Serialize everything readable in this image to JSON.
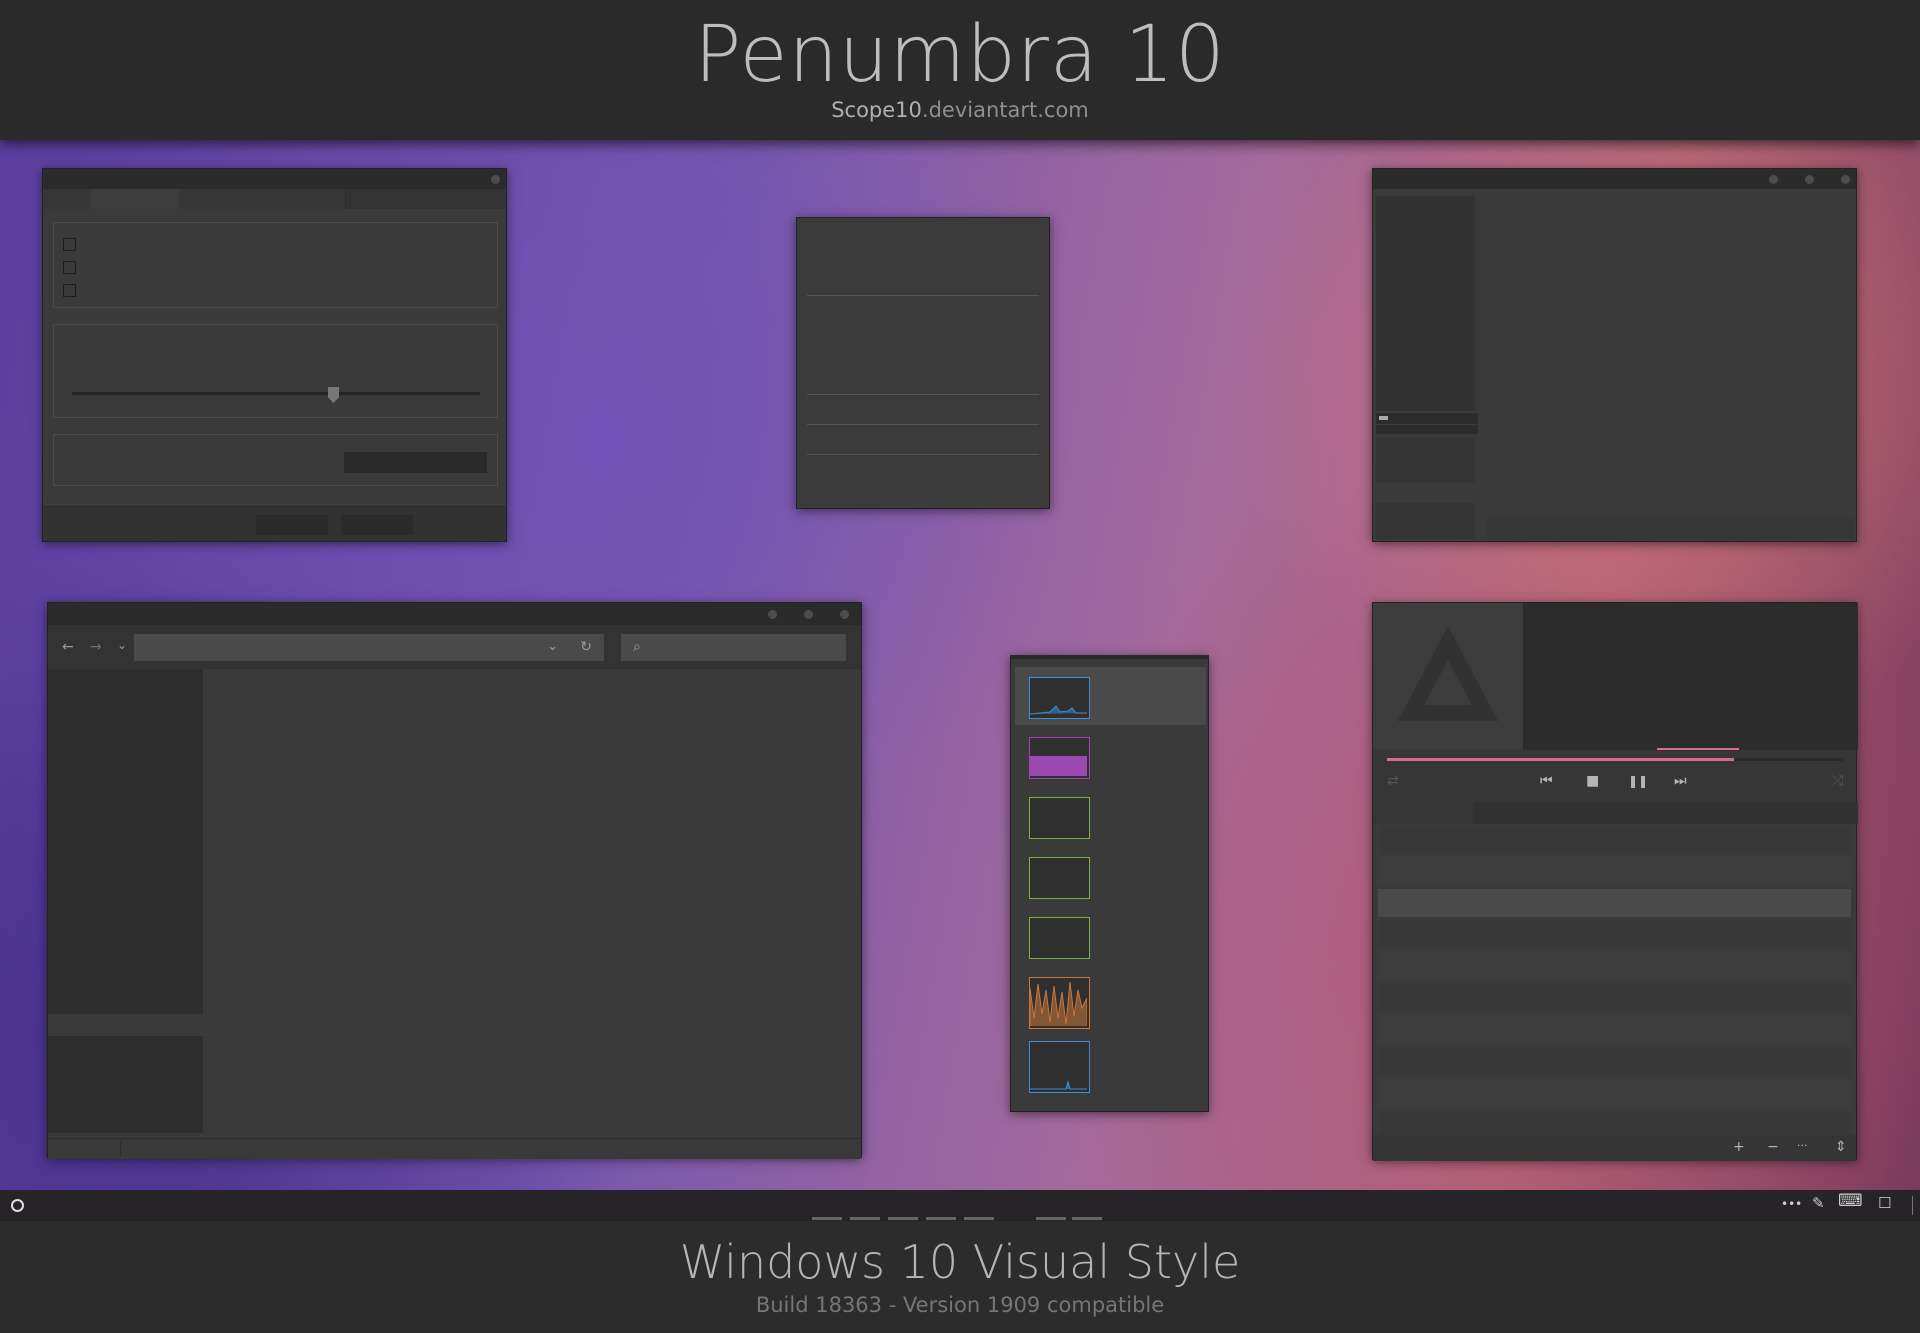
{
  "header": {
    "title": "Penumbra 10",
    "subtitle_user": "Scope10",
    "subtitle_domain": ".deviantart.com"
  },
  "footer": {
    "title": "Windows 10 Visual Style",
    "subtitle": "Build 18363 - Version 1909 compatible"
  },
  "colors": {
    "background": "#2b2b2b",
    "window": "#3a3a3a",
    "titlebar": "#2b2b2b",
    "accent_pink": "#d96a8a",
    "graph_blue": "#3a8fd6",
    "graph_purple": "#9b49b0",
    "graph_green": "#7fae3c",
    "graph_orange": "#c8773a"
  },
  "icons": {
    "back": "←",
    "forward": "→",
    "dropdown": "⌄",
    "refresh": "↻",
    "search": "⌕",
    "repeat": "⇄",
    "prev": "⏮",
    "stop": "■",
    "pause": "❚❚",
    "next": "⏭",
    "shuffle": "⤮",
    "add": "+",
    "remove": "−",
    "more": "···",
    "sort": "⇕",
    "start": "○",
    "tray_more": "•••",
    "pen": "✎",
    "keyboard": "⌨",
    "notifications": "☐"
  }
}
